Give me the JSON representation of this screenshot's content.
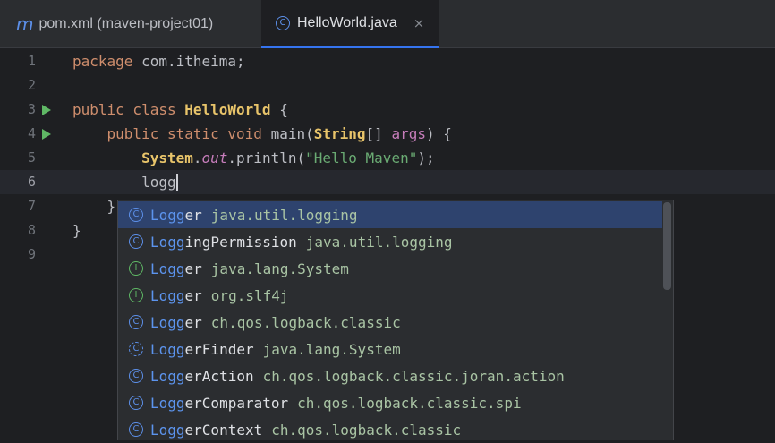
{
  "tabs": [
    {
      "icon": "maven-icon",
      "icon_glyph": "m",
      "label": "pom.xml (maven-project01)",
      "active": false
    },
    {
      "icon": "class-icon",
      "icon_glyph": "C",
      "label": "HelloWorld.java",
      "active": true,
      "close": "×"
    }
  ],
  "editor": {
    "current_line": 6,
    "lines": [
      {
        "number": "1",
        "tokens": [
          [
            "kw",
            "package "
          ],
          [
            "plain",
            "com.itheima;"
          ]
        ]
      },
      {
        "number": "2",
        "tokens": []
      },
      {
        "number": "3",
        "run": true,
        "tokens": [
          [
            "kw",
            "public class "
          ],
          [
            "cls",
            "HelloWorld"
          ],
          [
            "plain",
            " {"
          ]
        ]
      },
      {
        "number": "4",
        "run": true,
        "tokens": [
          [
            "plain",
            "    "
          ],
          [
            "kw",
            "public static void "
          ],
          [
            "plain",
            "main("
          ],
          [
            "cls",
            "String"
          ],
          [
            "plain",
            "[] "
          ],
          [
            "param",
            "args"
          ],
          [
            "plain",
            ") {"
          ]
        ]
      },
      {
        "number": "5",
        "tokens": [
          [
            "plain",
            "        "
          ],
          [
            "cls",
            "System"
          ],
          [
            "plain",
            "."
          ],
          [
            "fld",
            "out"
          ],
          [
            "plain",
            ".println("
          ],
          [
            "str",
            "\"Hello Maven\""
          ],
          [
            "plain",
            ");"
          ]
        ]
      },
      {
        "number": "6",
        "tokens": [
          [
            "plain",
            "        logg"
          ]
        ],
        "cursor": true
      },
      {
        "number": "7",
        "tokens": [
          [
            "plain",
            "    }"
          ]
        ]
      },
      {
        "number": "8",
        "tokens": [
          [
            "plain",
            "}"
          ]
        ]
      },
      {
        "number": "9",
        "tokens": []
      }
    ]
  },
  "completion": {
    "typed": "Logg",
    "items": [
      {
        "kind": "class",
        "glyph": "C",
        "name": "Logger",
        "package": "java.util.logging",
        "selected": true
      },
      {
        "kind": "class",
        "glyph": "C",
        "name": "LoggingPermission",
        "package": "java.util.logging"
      },
      {
        "kind": "interface",
        "glyph": "I",
        "name": "Logger",
        "package": "java.lang.System"
      },
      {
        "kind": "interface",
        "glyph": "I",
        "name": "Logger",
        "package": "org.slf4j"
      },
      {
        "kind": "class",
        "glyph": "C",
        "name": "Logger",
        "package": "ch.qos.logback.classic"
      },
      {
        "kind": "abstract-class",
        "glyph": "C",
        "name": "LoggerFinder",
        "package": "java.lang.System"
      },
      {
        "kind": "class",
        "glyph": "C",
        "name": "LoggerAction",
        "package": "ch.qos.logback.classic.joran.action"
      },
      {
        "kind": "class",
        "glyph": "C",
        "name": "LoggerComparator",
        "package": "ch.qos.logback.classic.spi"
      },
      {
        "kind": "class",
        "glyph": "C",
        "name": "LoggerContext",
        "package": "ch.qos.logback.classic"
      }
    ]
  },
  "colors": {
    "accent": "#3574f0",
    "class_icon": "#5c8fe8",
    "interface_icon": "#5fb865",
    "selection": "#2e436e"
  }
}
